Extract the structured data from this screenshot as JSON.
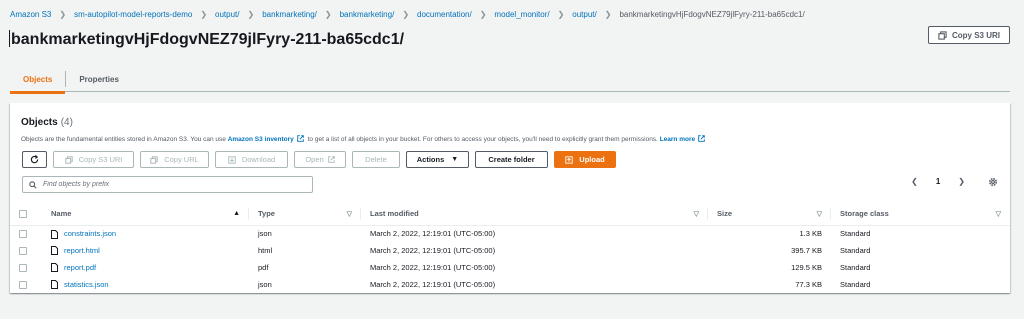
{
  "breadcrumb": [
    {
      "label": "Amazon S3",
      "link": true
    },
    {
      "label": "sm-autopilot-model-reports-demo",
      "link": true
    },
    {
      "label": "output/",
      "link": true
    },
    {
      "label": "bankmarketing/",
      "link": true
    },
    {
      "label": "bankmarketing/",
      "link": true
    },
    {
      "label": "documentation/",
      "link": true
    },
    {
      "label": "model_monitor/",
      "link": true
    },
    {
      "label": "output/",
      "link": true
    },
    {
      "label": "bankmarketingvHjFdogvNEZ79jlFyry-211-ba65cdc1/",
      "link": false
    }
  ],
  "page": {
    "title": "bankmarketingvHjFdogvNEZ79jlFyry-211-ba65cdc1/",
    "copy_s3_uri": "Copy S3 URI"
  },
  "tabs": [
    {
      "label": "Objects",
      "active": true
    },
    {
      "label": "Properties",
      "active": false
    }
  ],
  "objects_panel": {
    "title": "Objects",
    "count": "(4)",
    "desc_prefix": "Objects are the fundamental entities stored in Amazon S3. You can use",
    "desc_link1": "Amazon S3 inventory",
    "desc_mid": "to get a list of all objects in your bucket. For others to access your objects, you'll need to explicitly grant them permissions.",
    "desc_link2": "Learn more"
  },
  "toolbar": {
    "copy_s3_uri": "Copy S3 URI",
    "copy_url": "Copy URL",
    "download": "Download",
    "open": "Open",
    "delete": "Delete",
    "actions": "Actions",
    "create_folder": "Create folder",
    "upload": "Upload"
  },
  "search": {
    "placeholder": "Find objects by prefix"
  },
  "pagination": {
    "current_page": "1"
  },
  "table": {
    "columns": [
      "Name",
      "Type",
      "Last modified",
      "Size",
      "Storage class"
    ],
    "rows": [
      {
        "name": "constraints.json",
        "type": "json",
        "last_modified": "March 2, 2022, 12:19:01 (UTC-05:00)",
        "size": "1.3 KB",
        "storage_class": "Standard"
      },
      {
        "name": "report.html",
        "type": "html",
        "last_modified": "March 2, 2022, 12:19:01 (UTC-05:00)",
        "size": "395.7 KB",
        "storage_class": "Standard"
      },
      {
        "name": "report.pdf",
        "type": "pdf",
        "last_modified": "March 2, 2022, 12:19:01 (UTC-05:00)",
        "size": "129.5 KB",
        "storage_class": "Standard"
      },
      {
        "name": "statistics.json",
        "type": "json",
        "last_modified": "March 2, 2022, 12:19:01 (UTC-05:00)",
        "size": "77.3 KB",
        "storage_class": "Standard"
      }
    ]
  },
  "colors": {
    "accent": "#ec7211",
    "link": "#0073bb",
    "text": "#16191f",
    "muted": "#545b64",
    "background": "#f2f3f3"
  },
  "icons": [
    "copy-icon",
    "external-link-icon",
    "refresh-icon",
    "download-icon",
    "caret-down-icon",
    "upload-icon",
    "search-icon",
    "chevron-left-icon",
    "chevron-right-icon",
    "settings-icon",
    "file-icon",
    "sort-icon"
  ]
}
